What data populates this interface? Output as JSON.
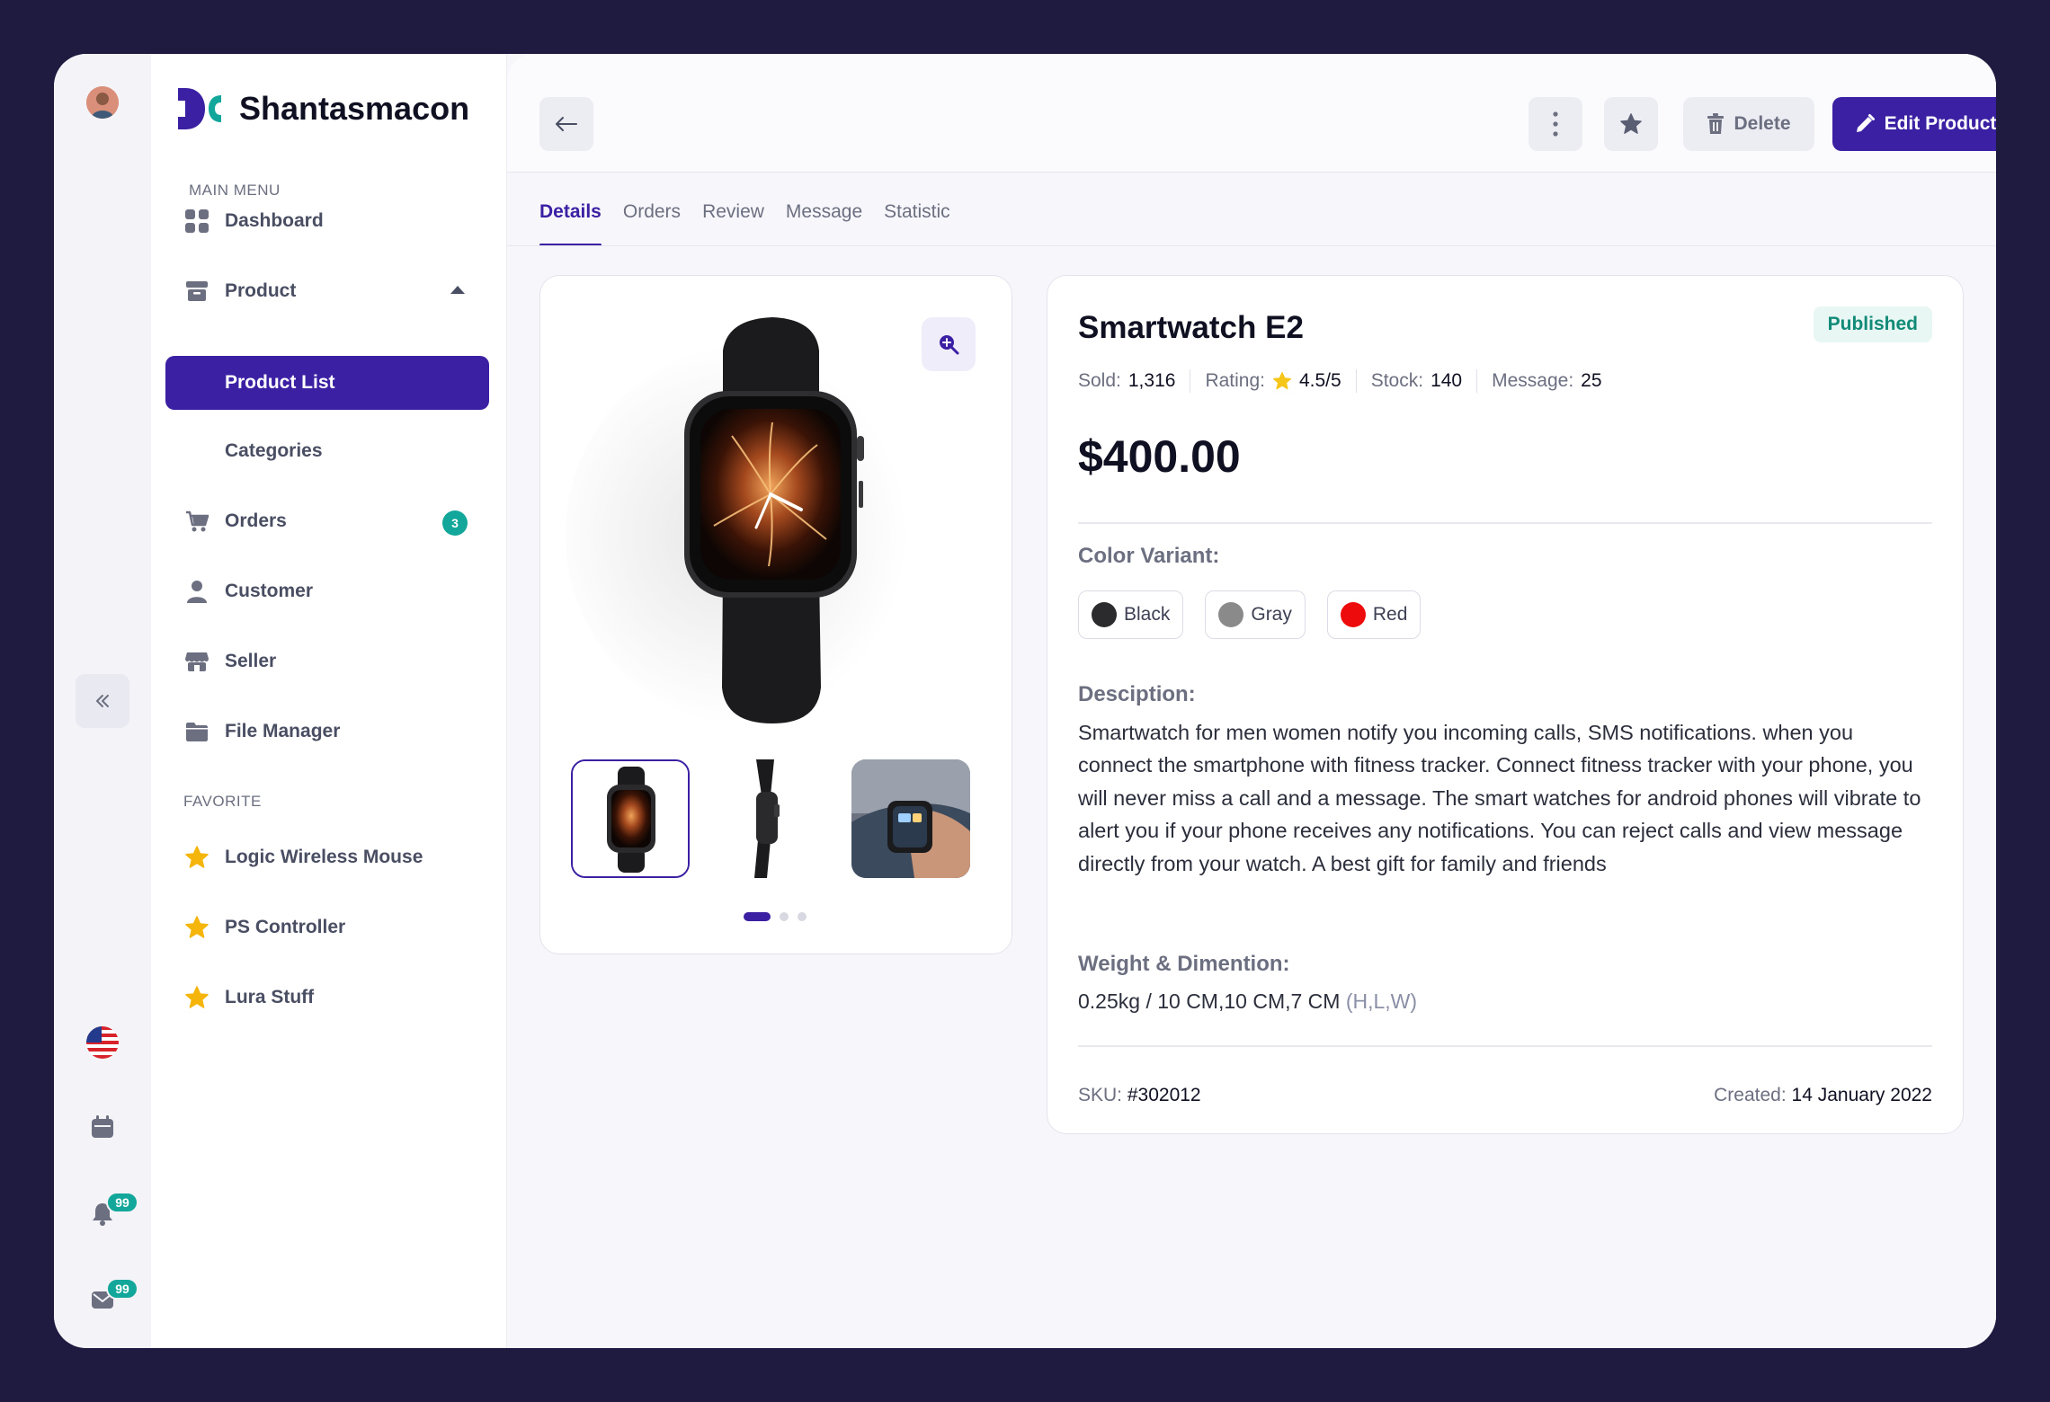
{
  "app": {
    "name": "Shantasmacon"
  },
  "sidebar": {
    "main_menu_title": "MAIN MENU",
    "favorite_title": "FAVORITE",
    "items": [
      {
        "label": "Dashboard",
        "icon": "grid-icon"
      },
      {
        "label": "Product",
        "icon": "archive-icon",
        "expanded": true
      },
      {
        "label": "Product List",
        "active": true
      },
      {
        "label": "Categories"
      },
      {
        "label": "Orders",
        "icon": "cart-icon",
        "badge": "3"
      },
      {
        "label": "Customer",
        "icon": "user-icon"
      },
      {
        "label": "Seller",
        "icon": "store-icon"
      },
      {
        "label": "File Manager",
        "icon": "folder-icon"
      }
    ],
    "favorites": [
      {
        "label": "Logic Wireless Mouse"
      },
      {
        "label": "PS Controller"
      },
      {
        "label": "Lura Stuff"
      }
    ]
  },
  "rail": {
    "notifications_badge": "99",
    "messages_badge": "99"
  },
  "toolbar": {
    "delete_label": "Delete",
    "edit_label": "Edit Product"
  },
  "tabs": [
    {
      "label": "Details",
      "active": true
    },
    {
      "label": "Orders"
    },
    {
      "label": "Review"
    },
    {
      "label": "Message"
    },
    {
      "label": "Statistic"
    }
  ],
  "gallery": {
    "thumbnail_count": 3,
    "active_index": 0
  },
  "product": {
    "title": "Smartwatch E2",
    "status": "Published",
    "sold_label": "Sold:",
    "sold": "1,316",
    "rating_label": "Rating:",
    "rating": "4.5/5",
    "stock_label": "Stock:",
    "stock": "140",
    "message_label": "Message:",
    "messages": "25",
    "price": "$400.00",
    "color_variant_label": "Color Variant:",
    "variants": [
      {
        "name": "Black",
        "color": "#2b2b2e"
      },
      {
        "name": "Gray",
        "color": "#8a8a8a"
      },
      {
        "name": "Red",
        "color": "#ee0b0b"
      }
    ],
    "description_label": "Desciption:",
    "description": "Smartwatch for men women notify you incoming calls, SMS notifications. when you connect the smartphone with fitness tracker. Connect fitness tracker with your phone, you will never miss a call and a message. The smart watches for android phones will vibrate to alert you if your phone receives any notifications. You can reject calls and view message directly from your watch. A best gift for family and friends",
    "weight_label": "Weight & Dimention:",
    "weight_value": "0.25kg / 10 CM,10 CM,7 CM",
    "weight_units": "(H,L,W)",
    "sku_label": "SKU:",
    "sku": "#302012",
    "created_label": "Created:",
    "created": "14 January 2022"
  },
  "colors": {
    "accent": "#3b20a3",
    "teal": "#12a79a",
    "star": "#f5b50b"
  }
}
